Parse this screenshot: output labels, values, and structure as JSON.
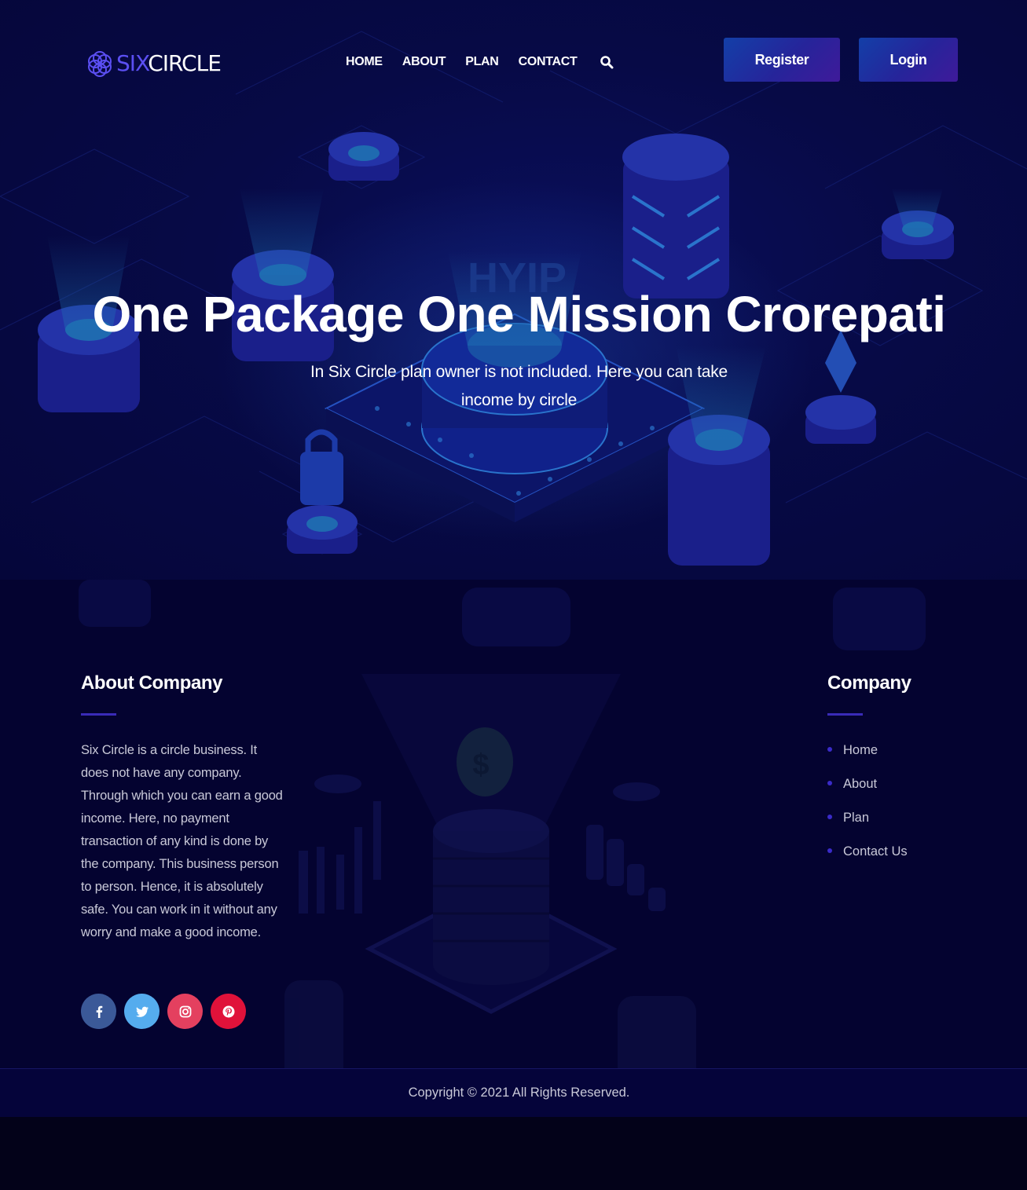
{
  "brand": {
    "name_part1": "SIX",
    "name_part2": "CIRCLE",
    "accent_color": "#5b4ff2"
  },
  "nav": {
    "items": [
      "HOME",
      "ABOUT",
      "PLAN",
      "CONTACT"
    ],
    "search_icon": "search-icon"
  },
  "actions": {
    "register_label": "Register",
    "login_label": "Login"
  },
  "hero": {
    "background_word": "HYIP",
    "title": "One Package One Mission Crorepati",
    "subtitle": "In Six Circle plan owner is not included. Here you can take income by circle"
  },
  "footer": {
    "about": {
      "title": "About Company",
      "text": "Six Circle is a circle business. It does not have any company. Through which you can earn a good income. Here, no payment transaction of any kind is done by the company. This business person to person. Hence, it is absolutely safe. You can work in it without any worry and make a good income."
    },
    "socials": [
      {
        "icon": "facebook-icon",
        "color": "#3b5998"
      },
      {
        "icon": "twitter-icon",
        "color": "#55acee"
      },
      {
        "icon": "instagram-icon",
        "color": "#e4405f"
      },
      {
        "icon": "pinterest-icon",
        "color": "#e0123a"
      }
    ],
    "company": {
      "title": "Company",
      "links": [
        "Home",
        "About",
        "Plan",
        "Contact Us"
      ]
    },
    "copyright": "Copyright © 2021 All Rights Reserved."
  }
}
